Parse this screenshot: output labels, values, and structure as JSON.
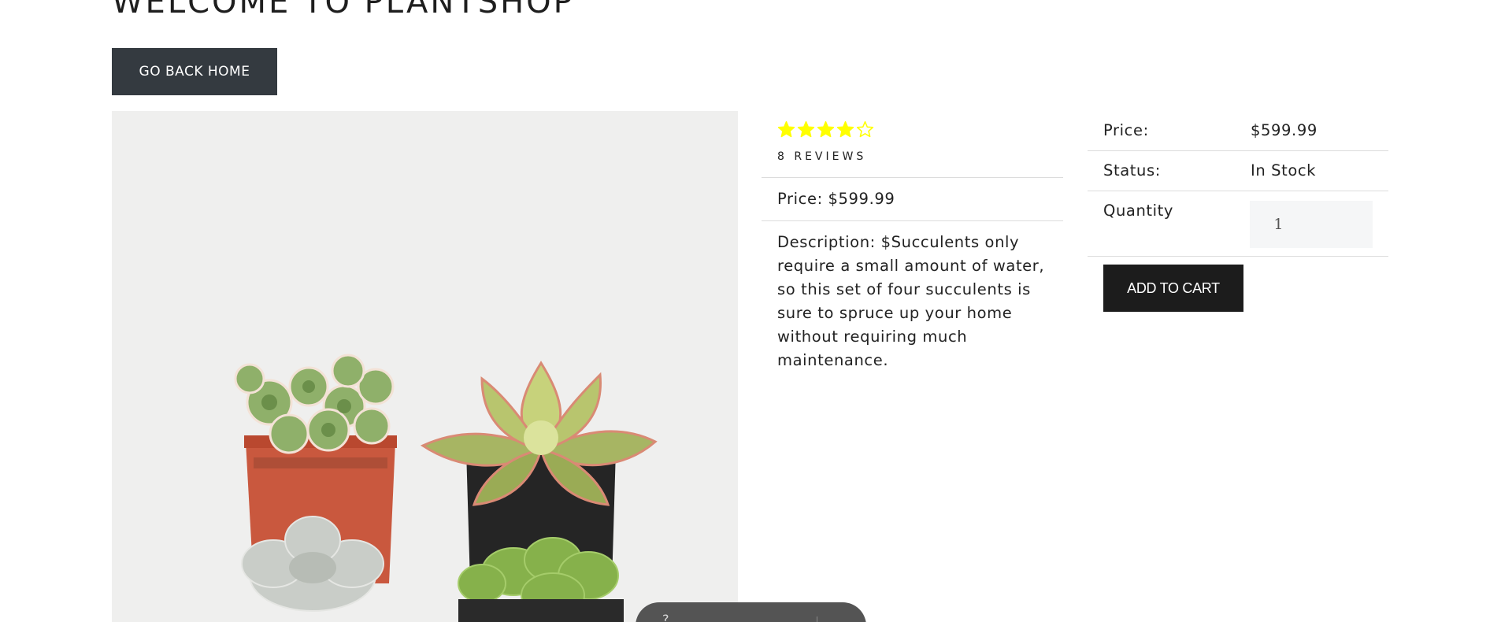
{
  "header": {
    "title": "WELCOME TO PLANTSHOP",
    "back_label": "GO BACK HOME"
  },
  "product": {
    "rating": 4,
    "rating_max": 5,
    "star_color": "#ffff00",
    "reviews": "8 REVIEWS",
    "price_line": "Price: $599.99",
    "description": "Description: $Succulents only require a small amount of water, so this set of four succulents is sure to spruce up your home without requiring much maintenance."
  },
  "summary": {
    "price_label": "Price:",
    "price_value": "$599.99",
    "status_label": "Status:",
    "status_value": "In Stock",
    "quantity_label": "Quantity",
    "quantity_value": "1",
    "add_to_cart_label": "ADD TO CART"
  },
  "pill": {
    "text": "?"
  }
}
